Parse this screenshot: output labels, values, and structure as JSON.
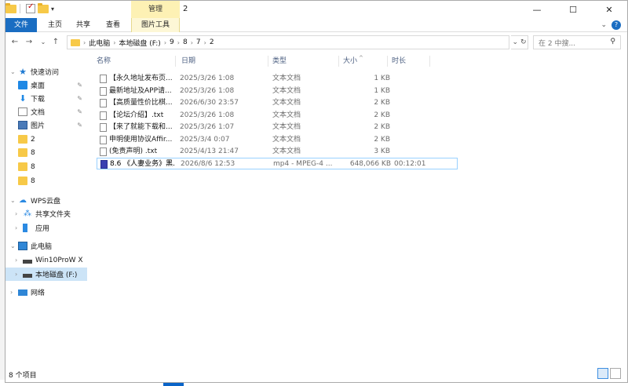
{
  "window": {
    "title": "2",
    "context_tab_top": "管理",
    "controls": [
      "—",
      "☐",
      "✕"
    ]
  },
  "ribbon": {
    "tabs": [
      "文件",
      "主页",
      "共享",
      "查看",
      "图片工具"
    ],
    "help": "?"
  },
  "address": {
    "crumbs": [
      "此电脑",
      "本地磁盘 (F:)",
      "9",
      "8",
      "7",
      "2"
    ],
    "search_placeholder": "在 2 中搜...",
    "nav": [
      "←",
      "→",
      "⌄",
      "↑"
    ],
    "dropdown": "⌄",
    "refresh": "↻"
  },
  "navpane": {
    "quick_access": "快速访问",
    "pinned": [
      {
        "label": "桌面",
        "icon": "desktop-icon"
      },
      {
        "label": "下载",
        "icon": "download-icon"
      },
      {
        "label": "文档",
        "icon": "document-icon"
      },
      {
        "label": "图片",
        "icon": "pictures-icon"
      }
    ],
    "folders": [
      "2",
      "8",
      "8",
      "8"
    ],
    "wps": "WPS云盘",
    "wps_items": [
      "共享文件夹",
      "应用"
    ],
    "this_pc": "此电脑",
    "pc_items": [
      "Win10ProW X",
      "本地磁盘 (F:)"
    ],
    "network": "网络"
  },
  "columns": {
    "name": "名称",
    "date": "日期",
    "type": "类型",
    "size": "大小",
    "duration": "时长"
  },
  "files": [
    {
      "name": "【永久地址发布页...",
      "date": "2025/3/26 1:08",
      "type": "文本文档",
      "size": "1 KB",
      "duration": ""
    },
    {
      "name": "最新地址及APP请...",
      "date": "2025/3/26 1:08",
      "type": "文本文档",
      "size": "1 KB",
      "duration": ""
    },
    {
      "name": "【高质量性价比棋...",
      "date": "2026/6/30 23:57",
      "type": "文本文档",
      "size": "2 KB",
      "duration": ""
    },
    {
      "name": "【论坛介绍】.txt",
      "date": "2025/3/26 1:08",
      "type": "文本文档",
      "size": "2 KB",
      "duration": ""
    },
    {
      "name": "【来了就能下载和...",
      "date": "2025/3/26 1:07",
      "type": "文本文档",
      "size": "2 KB",
      "duration": ""
    },
    {
      "name": "申明使用协议Affir...",
      "date": "2025/3/4 0:07",
      "type": "文本文档",
      "size": "2 KB",
      "duration": ""
    },
    {
      "name": "(免责声明) .txt",
      "date": "2025/4/13 21:47",
      "type": "文本文档",
      "size": "3 KB",
      "duration": ""
    },
    {
      "name": "8.6 《人妻业务》黑...",
      "date": "2026/8/6 12:53",
      "type": "mp4 - MPEG-4 ...",
      "size": "648,066 KB",
      "duration": "00:12:01"
    }
  ],
  "status": {
    "count": "8 个项目"
  }
}
